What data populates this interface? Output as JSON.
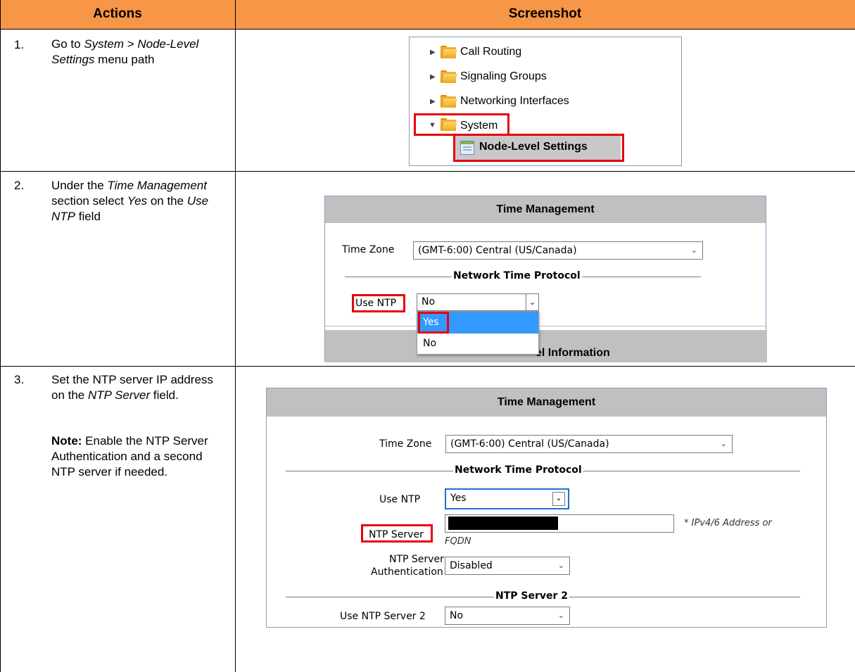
{
  "header": {
    "actions": "Actions",
    "screenshot": "Screenshot"
  },
  "steps": [
    {
      "num": "1.",
      "text_a": "Go to ",
      "text_b": "System",
      "text_c": " > ",
      "text_d": "Node-Level Settings",
      "text_e": " menu path"
    },
    {
      "num": "2.",
      "text_a": "Under the ",
      "text_b": "Time Management",
      "text_c": " section select ",
      "text_d": "Yes",
      "text_e": " on the ",
      "text_f": "Use NTP",
      "text_g": " field"
    },
    {
      "num": "3.",
      "text_a": "Set the NTP server IP address on the ",
      "text_b": "NTP Server",
      "text_c": " field.",
      "note_label": "Note:",
      "note_text": " Enable the NTP Server Authentication and a second NTP server if needed."
    }
  ],
  "tree": {
    "items": [
      "Call Routing",
      "Signaling Groups",
      "Networking Interfaces",
      "System",
      "Node-Level Settings"
    ]
  },
  "panel1": {
    "title": "Time Management",
    "time_zone_label": "Time Zone",
    "time_zone_value": "(GMT-6:00) Central (US/Canada)",
    "section": "Network Time Protocol",
    "use_ntp_label": "Use NTP",
    "use_ntp_value": "No",
    "options": [
      "Yes",
      "No"
    ],
    "bottom_partial": "el Information"
  },
  "panel2": {
    "title": "Time Management",
    "time_zone_label": "Time Zone",
    "time_zone_value": "(GMT-6:00) Central (US/Canada)",
    "section": "Network Time Protocol",
    "use_ntp_label": "Use NTP",
    "use_ntp_value": "Yes",
    "ntp_server_label": "NTP Server",
    "ntp_hint_a": "* IPv4/6 Address or",
    "ntp_hint_b": "FQDN",
    "auth_label_a": "NTP Server",
    "auth_label_b": "Authentication",
    "auth_value": "Disabled",
    "section2": "NTP Server 2",
    "use_ntp2_label": "Use NTP Server 2",
    "use_ntp2_value": "No"
  },
  "colors": {
    "header": "#f79646",
    "highlight": "#e8000b",
    "selected": "#3399ff"
  }
}
